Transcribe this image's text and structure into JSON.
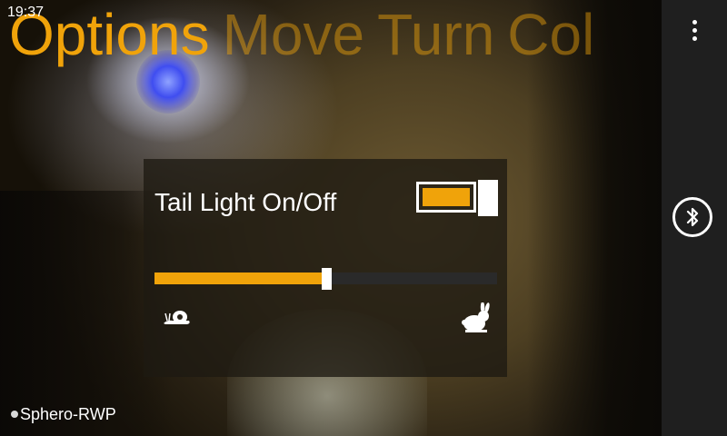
{
  "status_bar": {
    "time": "19:37"
  },
  "pivot": {
    "headers": [
      "Options",
      "Move",
      "Turn",
      "Col"
    ],
    "active_index": 0,
    "accent_color": "#f0a30a"
  },
  "options_panel": {
    "tail_light_label": "Tail Light On/Off",
    "tail_light_on": true,
    "speed_slider_value": 0.5,
    "speed_slider_min_icon": "snail-icon",
    "speed_slider_max_icon": "rabbit-icon"
  },
  "app_bar": {
    "more_icon": "more-dots-icon",
    "bluetooth_icon": "bluetooth-icon"
  },
  "device": {
    "name": "Sphero-RWP"
  }
}
